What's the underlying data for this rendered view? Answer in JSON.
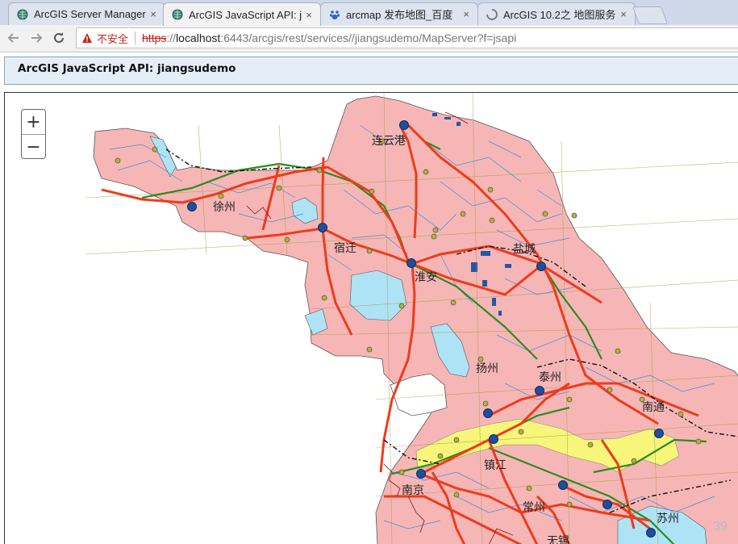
{
  "browser": {
    "tabs": [
      {
        "title": "ArcGIS Server Manager",
        "active": false,
        "icon": "globe-icon"
      },
      {
        "title": "ArcGIS JavaScript API: j",
        "active": true,
        "icon": "globe-icon"
      },
      {
        "title": "arcmap 发布地图_百度",
        "active": false,
        "icon": "baidu-paw-icon"
      },
      {
        "title": "ArcGIS 10.2之 地图服务",
        "active": false,
        "icon": "loading-icon"
      }
    ],
    "close_glyph": "×",
    "security_text": "不安全",
    "url": {
      "scheme": "https",
      "separator": "://",
      "host": "localhost",
      "rest": ":6443/arcgis/rest/services//jiangsudemo/MapServer?f=jsapi"
    }
  },
  "app": {
    "title": "ArcGIS JavaScript API: jiangsudemo"
  },
  "map": {
    "zoom_in": "+",
    "zoom_out": "−",
    "cities": [
      "连云港",
      "徐州",
      "宿迁",
      "盐城",
      "淮安",
      "扬州",
      "泰州",
      "南通",
      "镇江",
      "南京",
      "常州",
      "苏州",
      "无锡"
    ],
    "colors": {
      "land": "#f6b6b6",
      "water": "#aee3f5",
      "road": "#ee3b1b",
      "rail": "#2e8b1e",
      "city_point": "#1f4e9c",
      "town_point": "#b7b32a"
    },
    "watermark": "39"
  }
}
